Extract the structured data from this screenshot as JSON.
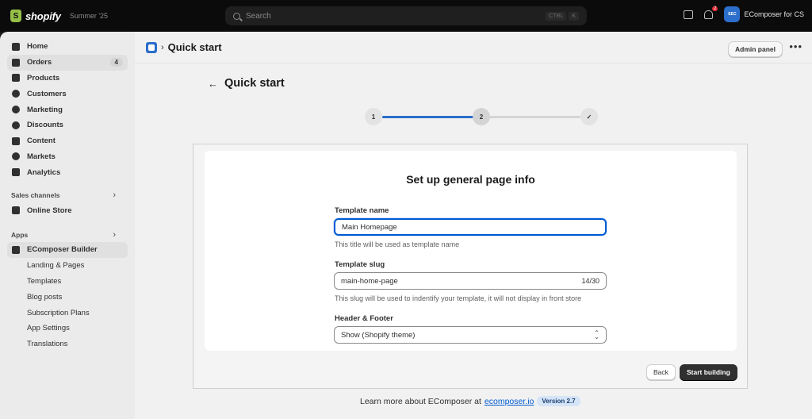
{
  "topbar": {
    "brand": "shopify",
    "edition": "Summer '25",
    "search_placeholder": "Search",
    "shortcut_keys": [
      "CTRL",
      "K"
    ],
    "notification_count": "2",
    "account_initials": "EEC",
    "account_name": "EComposer for CS"
  },
  "sidebar": {
    "items": [
      {
        "label": "Home"
      },
      {
        "label": "Orders",
        "badge": "4"
      },
      {
        "label": "Products"
      },
      {
        "label": "Customers"
      },
      {
        "label": "Marketing"
      },
      {
        "label": "Discounts"
      },
      {
        "label": "Content"
      },
      {
        "label": "Markets"
      },
      {
        "label": "Analytics"
      }
    ],
    "sales_channels_label": "Sales channels",
    "online_store_label": "Online Store",
    "apps_label": "Apps",
    "app_name": "EComposer Builder",
    "app_sub_items": [
      "Landing & Pages",
      "Templates",
      "Blog posts",
      "Subscription Plans",
      "App Settings",
      "Translations"
    ]
  },
  "header": {
    "title": "Quick start",
    "admin_panel_label": "Admin panel",
    "more_label": "•••"
  },
  "main": {
    "back_title": "Quick start",
    "steps": [
      "1",
      "2",
      "✓"
    ],
    "progress": 0.5
  },
  "modal": {
    "title": "Set up general page info",
    "template_name_label": "Template name",
    "template_name_value": "Main Homepage",
    "template_name_help": "This title will be used as template name",
    "template_slug_label": "Template slug",
    "template_slug_value": "main-home-page",
    "template_slug_counter": "14/30",
    "template_slug_help": "This slug will be used to indentify your template, it will not display in front store",
    "header_footer_label": "Header & Footer",
    "header_footer_value": "Show (Shopify theme)",
    "back_label": "Back",
    "start_label": "Start building"
  },
  "footer": {
    "text": "Learn more about EComposer at",
    "link": "ecomposer.io",
    "version": "Version 2.7"
  },
  "colors": {
    "accent": "#005bd3",
    "primary_button": "#303030",
    "progress_fill": "#2c6ecb"
  }
}
